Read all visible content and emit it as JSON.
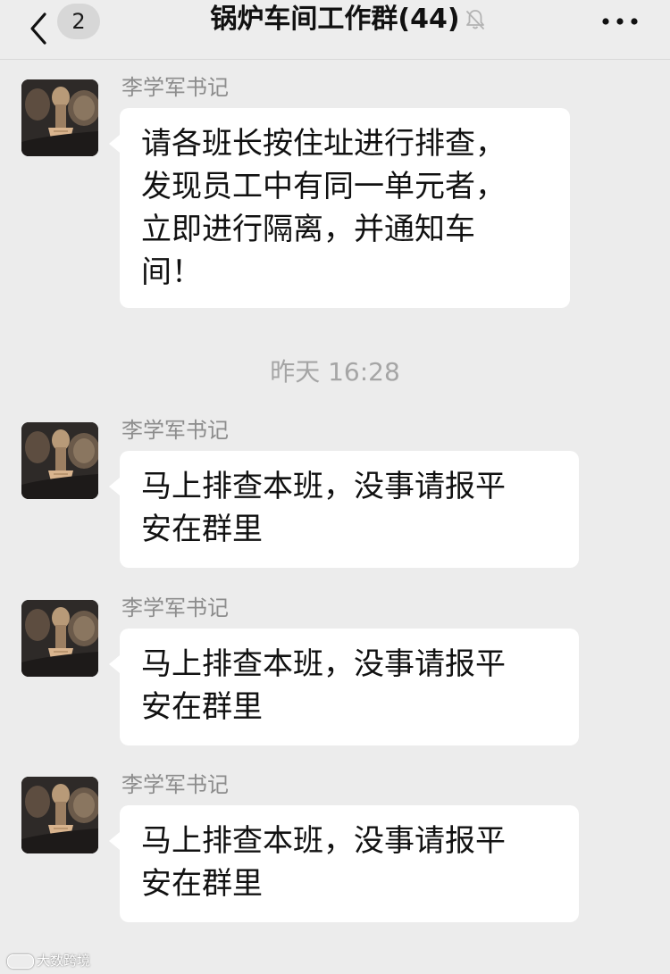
{
  "header": {
    "unread_count": "2",
    "title": "锅炉车间工作群(44)",
    "back_icon": "chevron-left-icon",
    "mute_icon": "bell-muted-icon",
    "more_icon": "more-dots-icon"
  },
  "messages": [
    {
      "sender": "李学军书记",
      "lines": [
        "请各班长按住址进行排查，",
        "发现员工中有同一单元者，",
        "立即进行隔离，并通知车",
        "间！"
      ]
    },
    {
      "sender": "李学军书记",
      "lines": [
        "马上排查本班，没事请报平",
        "安在群里"
      ]
    },
    {
      "sender": "李学军书记",
      "lines": [
        "马上排查本班，没事请报平",
        "安在群里"
      ]
    },
    {
      "sender": "李学军书记",
      "lines": [
        "马上排查本班，没事请报平",
        "安在群里"
      ]
    }
  ],
  "timestamp": "昨天 16:28",
  "watermark": "大数跨境"
}
